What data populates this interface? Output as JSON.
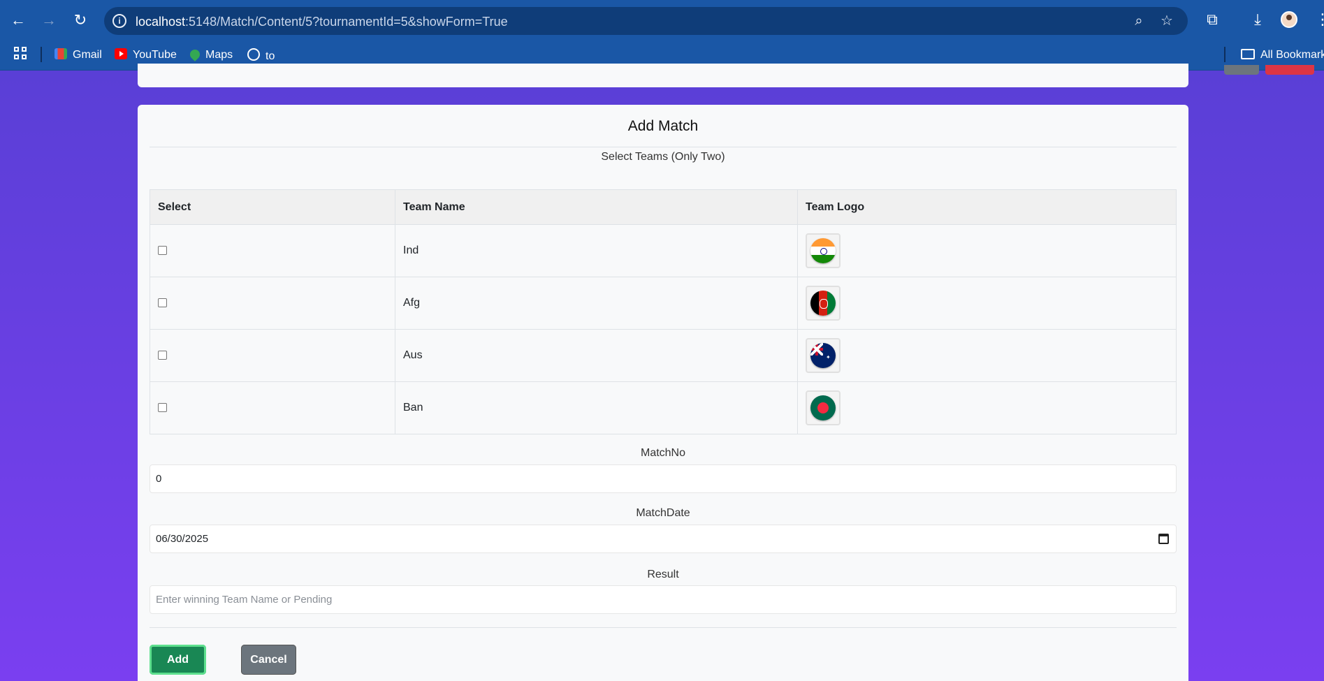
{
  "browser": {
    "url_host": "localhost",
    "url_rest": ":5148/Match/Content/5?tournamentId=5&showForm=True",
    "bookmarks": [
      {
        "label": "Gmail",
        "icon": "gmail-icon"
      },
      {
        "label": "YouTube",
        "icon": "youtube-icon"
      },
      {
        "label": "Maps",
        "icon": "maps-icon"
      },
      {
        "label": "to",
        "icon": "globe-icon"
      }
    ],
    "all_bookmarks_label": "All Bookmarks"
  },
  "form": {
    "title": "Add Match",
    "teams_label": "Select Teams (Only Two)",
    "table_headers": [
      "Select",
      "Team Name",
      "Team Logo"
    ],
    "teams": [
      {
        "name": "Ind",
        "logo": "india-flag-icon",
        "checked": false
      },
      {
        "name": "Afg",
        "logo": "afghanistan-flag-icon",
        "checked": false
      },
      {
        "name": "Aus",
        "logo": "australia-flag-icon",
        "checked": false
      },
      {
        "name": "Ban",
        "logo": "bangladesh-flag-icon",
        "checked": false
      }
    ],
    "match_no": {
      "label": "MatchNo",
      "value": "0"
    },
    "match_date": {
      "label": "MatchDate",
      "value": "06/30/2025"
    },
    "result": {
      "label": "Result",
      "value": "",
      "placeholder": "Enter winning Team Name or Pending"
    },
    "buttons": {
      "add": "Add Match",
      "cancel": "Cancel"
    }
  },
  "colors": {
    "chrome": "#1a57a6",
    "page_gradient_top": "#5a3fd6",
    "page_gradient_bottom": "#7a3ff0",
    "add_button": "#198754",
    "cancel_button": "#6c757d",
    "delete_button": "#dc3545"
  }
}
